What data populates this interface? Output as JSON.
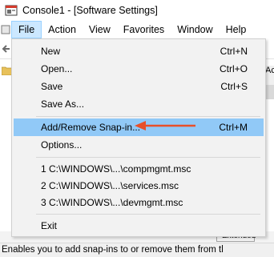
{
  "window": {
    "title": "Console1 - [Software Settings]"
  },
  "menubar": {
    "items": [
      {
        "label": "File",
        "active": true
      },
      {
        "label": "Action"
      },
      {
        "label": "View"
      },
      {
        "label": "Favorites"
      },
      {
        "label": "Window"
      },
      {
        "label": "Help"
      }
    ]
  },
  "file_menu": {
    "items": [
      {
        "label": "New",
        "accel": "Ctrl+N"
      },
      {
        "label": "Open...",
        "accel": "Ctrl+O"
      },
      {
        "label": "Save",
        "accel": "Ctrl+S"
      },
      {
        "label": "Save As...",
        "accel": ""
      },
      {
        "label": "Add/Remove Snap-in...",
        "accel": "Ctrl+M",
        "highlighted": true
      },
      {
        "label": "Options...",
        "accel": ""
      },
      {
        "label": "1 C:\\WINDOWS\\...\\compmgmt.msc",
        "accel": ""
      },
      {
        "label": "2 C:\\WINDOWS\\...\\services.msc",
        "accel": ""
      },
      {
        "label": "3 C:\\WINDOWS\\...\\devmgmt.msc",
        "accel": ""
      },
      {
        "label": "Exit",
        "accel": ""
      }
    ]
  },
  "background": {
    "right_pane_text": "Actio",
    "tab_label": "Extended"
  },
  "statusbar": {
    "text": "Enables you to add snap-ins to or remove them from tl"
  },
  "colors": {
    "highlight": "#91c9f7",
    "menu_active": "#cce8ff",
    "arrow": "#e8502a"
  },
  "icons": {
    "app": "mmc-console-icon",
    "back": "back-arrow-icon",
    "folder": "folder-icon",
    "pointer": "red-arrow-annotation"
  }
}
